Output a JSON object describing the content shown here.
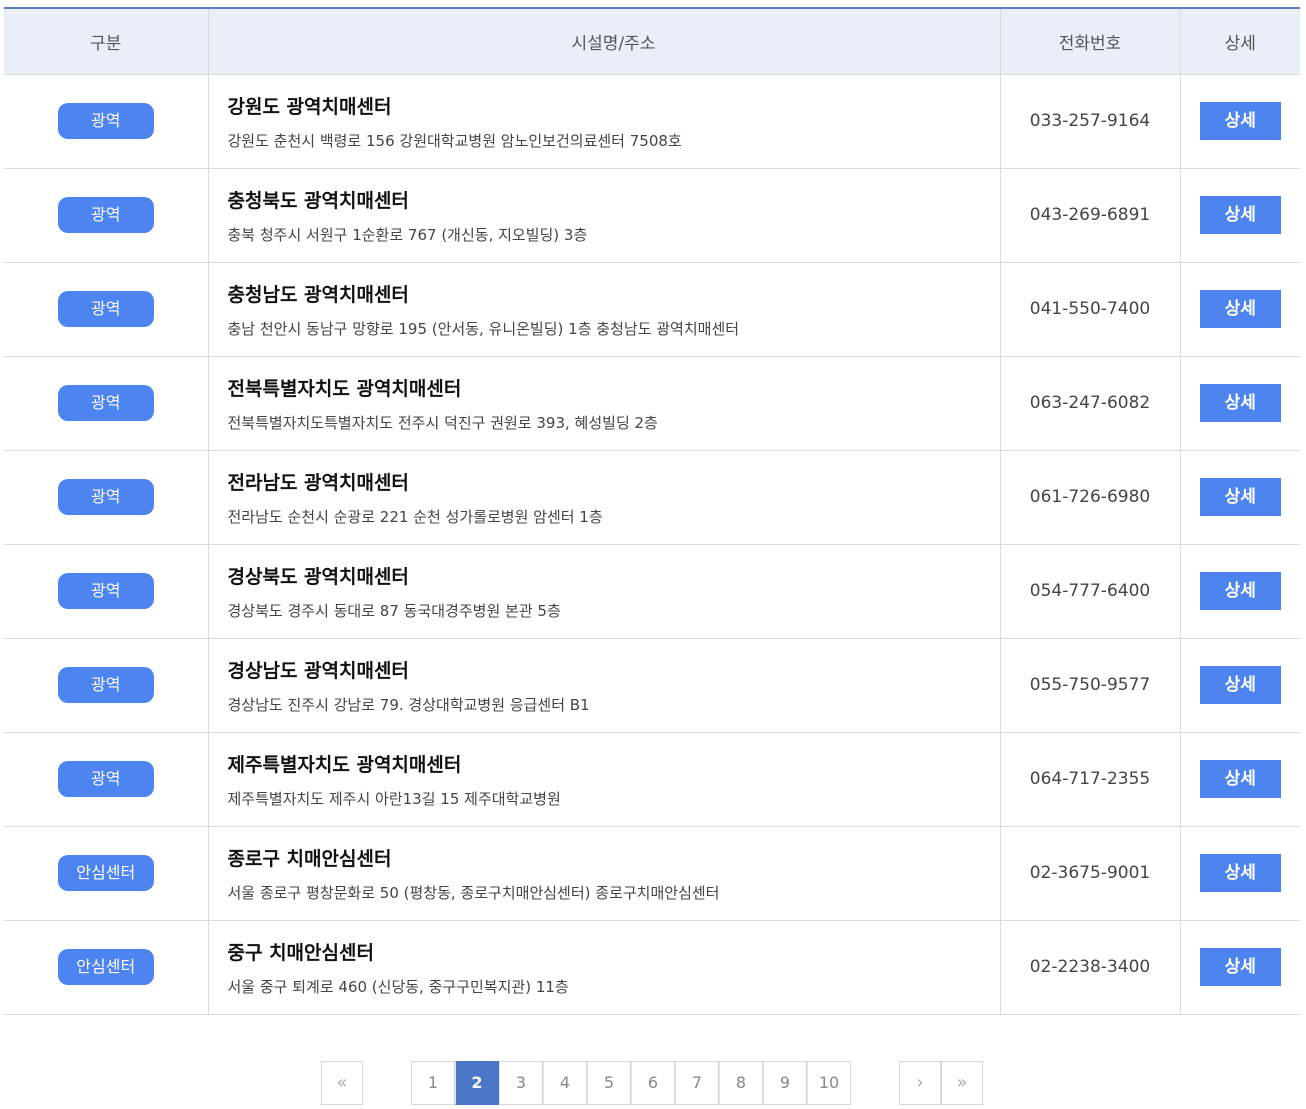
{
  "colors": {
    "accent": "#4d84f0",
    "header_bg": "#e9eef7",
    "page_active": "#4a76c8"
  },
  "table": {
    "headers": [
      "구분",
      "시설명/주소",
      "전화번호",
      "상세"
    ],
    "rows": [
      {
        "category": "광역",
        "name": "강원도 광역치매센터",
        "address": "강원도 춘천시 백령로 156 강원대학교병원 암노인보건의료센터 7508호",
        "phone": "033-257-9164",
        "detail": "상세"
      },
      {
        "category": "광역",
        "name": "충청북도 광역치매센터",
        "address": "충북 청주시 서원구 1순환로 767 (개신동, 지오빌딩) 3층",
        "phone": "043-269-6891",
        "detail": "상세"
      },
      {
        "category": "광역",
        "name": "충청남도 광역치매센터",
        "address": "충남 천안시 동남구 망향로 195 (안서동, 유니온빌딩) 1층 충청남도 광역치매센터",
        "phone": "041-550-7400",
        "detail": "상세"
      },
      {
        "category": "광역",
        "name": "전북특별자치도 광역치매센터",
        "address": "전북특별자치도특별자치도 전주시 덕진구 권원로 393, 혜성빌딩 2층",
        "phone": "063-247-6082",
        "detail": "상세"
      },
      {
        "category": "광역",
        "name": "전라남도 광역치매센터",
        "address": "전라남도 순천시 순광로 221 순천 성가롤로병원 암센터 1층",
        "phone": "061-726-6980",
        "detail": "상세"
      },
      {
        "category": "광역",
        "name": "경상북도 광역치매센터",
        "address": "경상북도 경주시 동대로 87 동국대경주병원 본관 5층",
        "phone": "054-777-6400",
        "detail": "상세"
      },
      {
        "category": "광역",
        "name": "경상남도 광역치매센터",
        "address": "경상남도 진주시 강남로 79. 경상대학교병원 응급센터 B1",
        "phone": "055-750-9577",
        "detail": "상세"
      },
      {
        "category": "광역",
        "name": "제주특별자치도 광역치매센터",
        "address": "제주특별자치도 제주시 아란13길 15 제주대학교병원",
        "phone": "064-717-2355",
        "detail": "상세"
      },
      {
        "category": "안심센터",
        "name": "종로구 치매안심센터",
        "address": "서울 종로구 평창문화로 50 (평창동, 종로구치매안심센터) 종로구치매안심센터",
        "phone": "02-3675-9001",
        "detail": "상세"
      },
      {
        "category": "안심센터",
        "name": "중구 치매안심센터",
        "address": "서울 중구 퇴계로 460 (신당동, 중구구민복지관) 11층",
        "phone": "02-2238-3400",
        "detail": "상세"
      }
    ]
  },
  "pagination": {
    "first_icon": "double-chevron-left-icon",
    "first_label": "«",
    "prev_icon": "chevron-left-icon",
    "prev_label": "‹",
    "next_icon": "chevron-right-icon",
    "next_label": "›",
    "last_icon": "double-chevron-right-icon",
    "last_label": "»",
    "pages": [
      "1",
      "2",
      "3",
      "4",
      "5",
      "6",
      "7",
      "8",
      "9",
      "10"
    ],
    "current": "2"
  }
}
